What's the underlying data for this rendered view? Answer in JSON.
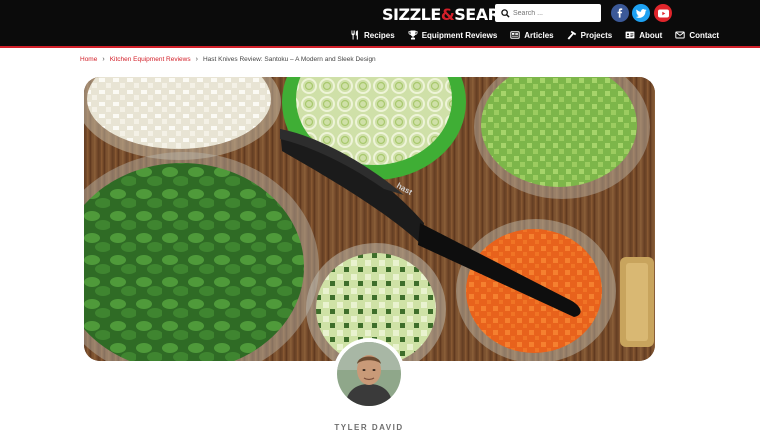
{
  "site": {
    "logo_main": "SIZZLE",
    "logo_amp": "&",
    "logo_end": "SEAR"
  },
  "search": {
    "placeholder": "Search ..."
  },
  "social": [
    {
      "name": "facebook",
      "icon": "facebook-icon",
      "color": "#3b5998"
    },
    {
      "name": "twitter",
      "icon": "twitter-icon",
      "color": "#1da1f2"
    },
    {
      "name": "youtube",
      "icon": "youtube-icon",
      "color": "#e0252b"
    }
  ],
  "nav": {
    "items": [
      {
        "label": "Recipes",
        "icon": "utensils-icon"
      },
      {
        "label": "Equipment Reviews",
        "icon": "trophy-icon"
      },
      {
        "label": "Articles",
        "icon": "newspaper-icon"
      },
      {
        "label": "Projects",
        "icon": "hammer-icon"
      },
      {
        "label": "About",
        "icon": "id-card-icon"
      },
      {
        "label": "Contact",
        "icon": "envelope-icon"
      }
    ]
  },
  "breadcrumb": {
    "home": "Home",
    "category": "Kitchen Equipment Reviews",
    "current": "Hast Knives Review: Santoku – A Modern and Sleek Design"
  },
  "hero": {
    "knife_brand": "hast"
  },
  "author": {
    "name": "TYLER DAVID"
  },
  "colors": {
    "header_bg": "#0b0b0b",
    "accent": "#d3202a"
  }
}
